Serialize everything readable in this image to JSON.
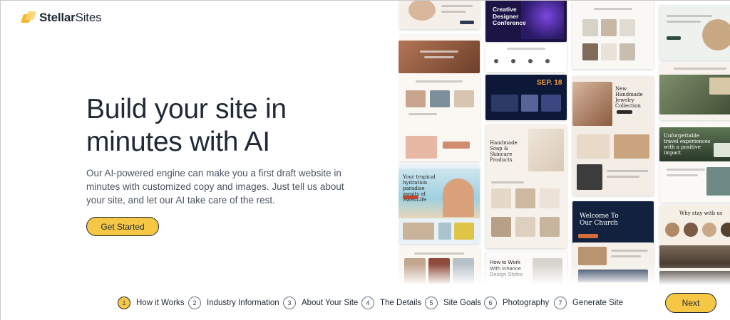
{
  "brand": {
    "name_bold": "Stellar",
    "name_light": "Sites"
  },
  "hero": {
    "title": "Build your site in minutes with AI",
    "body": "Our AI-powered engine can make you a first draft website in minutes with customized copy and images. Just tell us about your site, and let our AI take care of the rest.",
    "cta_label": "Get Started"
  },
  "gallery": {
    "tile_texts": {
      "creative": "Creative Designer Conference",
      "sep": "SEP. 18",
      "soap": "Handmade Soap & Skincare Products",
      "church": "Welcome To Our Church",
      "inharice": "How to Work With Inharice Design Styles",
      "hydration": "Your tropical hydration paradise awaits at SwellLife",
      "jewelry": "New Handmade Jewelry Collection",
      "travel": "Unforgettable travel experiences with a positive impact",
      "why": "Why stay with us"
    }
  },
  "steps": [
    {
      "number": "1",
      "label": "How it Works"
    },
    {
      "number": "2",
      "label": "Industry Information"
    },
    {
      "number": "3",
      "label": "About Your Site"
    },
    {
      "number": "4",
      "label": "The Details"
    },
    {
      "number": "5",
      "label": "Site Goals"
    },
    {
      "number": "6",
      "label": "Photography"
    },
    {
      "number": "7",
      "label": "Generate Site"
    }
  ],
  "next_label": "Next",
  "colors": {
    "accent": "#f6c744",
    "text": "#1f2937"
  }
}
